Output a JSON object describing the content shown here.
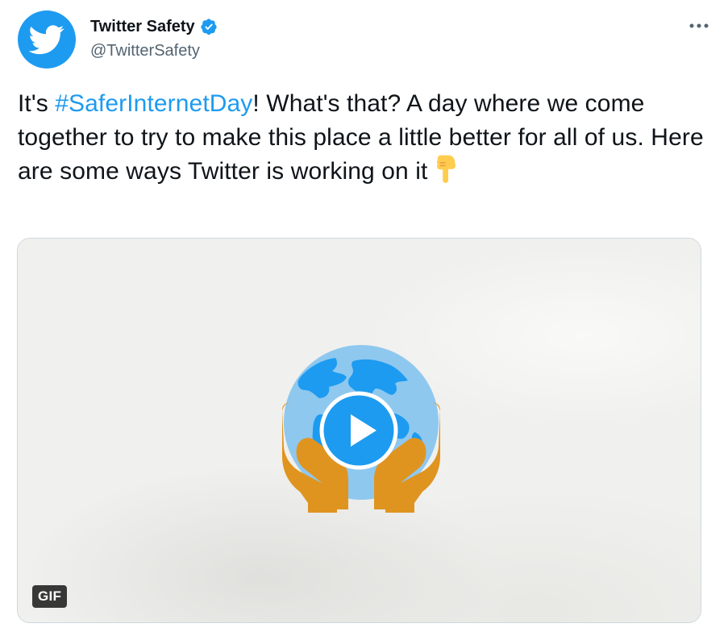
{
  "tweet": {
    "author": {
      "display_name": "Twitter Safety",
      "handle": "@TwitterSafety",
      "verified": true,
      "avatar_icon": "twitter-bird-icon"
    },
    "text": {
      "prefix": "It's ",
      "hashtag": "#SaferInternetDay",
      "body": "! What's that? A day where we come together to try to make this place a little better for all of us. Here are some ways Twitter is working on it",
      "emoji_name": "backhand-index-pointing-down-emoji"
    },
    "media": {
      "type": "GIF",
      "badge_label": "GIF",
      "illustration": "hands-holding-globe",
      "play_icon": "play-icon"
    }
  },
  "colors": {
    "accent": "#1d9bf0",
    "text_primary": "#0f1419",
    "text_secondary": "#536471",
    "hands": "#e09420",
    "globe_ocean": "#8ec8ef",
    "globe_land": "#1d9bf0"
  }
}
